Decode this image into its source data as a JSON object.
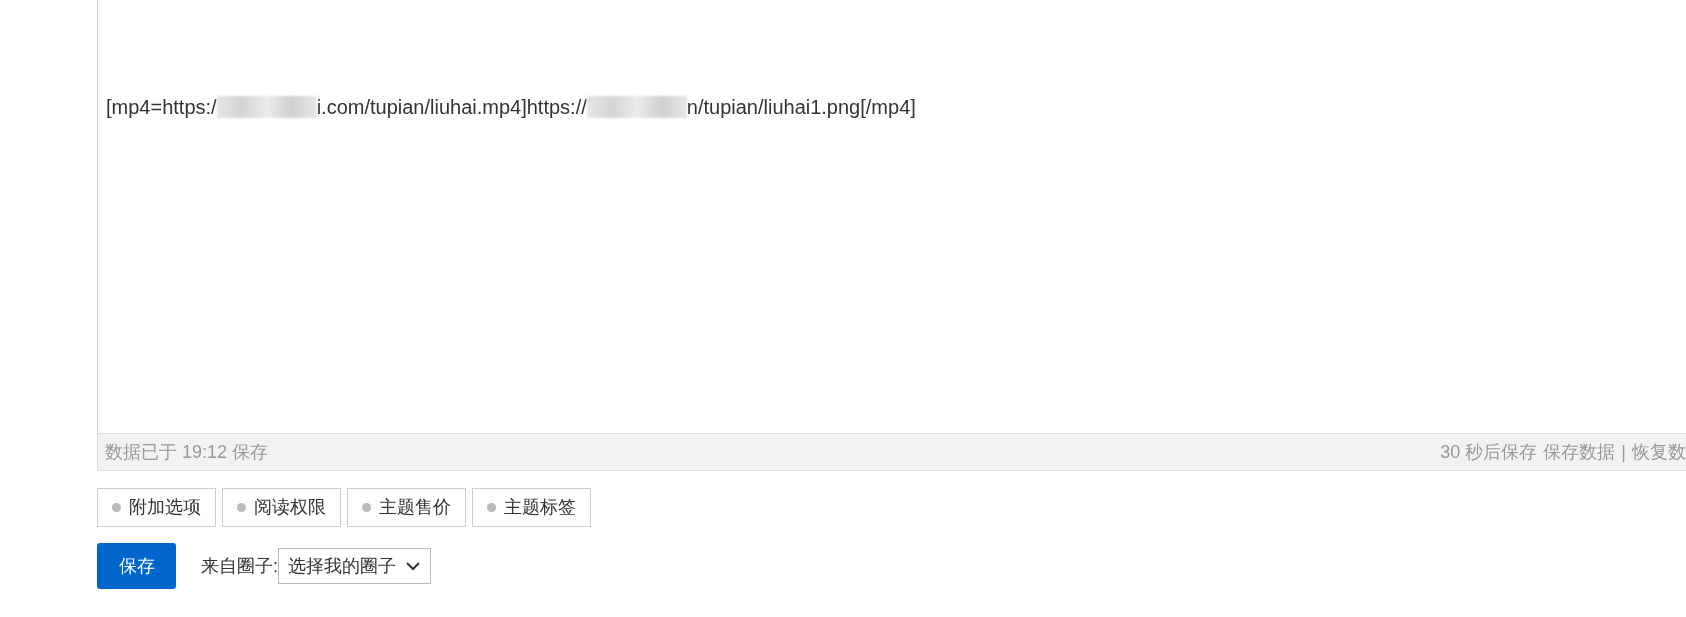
{
  "editor": {
    "line": [
      {
        "kind": "text",
        "text": "[mp4=https:/"
      },
      {
        "kind": "redacted"
      },
      {
        "kind": "text",
        "text": "i.com/tupian/liuhai.mp4]https://"
      },
      {
        "kind": "redacted"
      },
      {
        "kind": "text",
        "text": "n/tupian/liuhai1.png[/mp4]"
      }
    ]
  },
  "status_bar": {
    "left": "数据已于 19:12 保存",
    "countdown": "30 秒后保存",
    "save_link": "保存数据",
    "separator": "|",
    "restore_link": "恢复数"
  },
  "option_tabs": [
    {
      "label": "附加选项",
      "selected": false
    },
    {
      "label": "阅读权限",
      "selected": false
    },
    {
      "label": "主题售价",
      "selected": false
    },
    {
      "label": "主题标签",
      "selected": false
    }
  ],
  "save_button": "保存",
  "circle": {
    "label": "来自圈子:",
    "value": "选择我的圈子"
  }
}
